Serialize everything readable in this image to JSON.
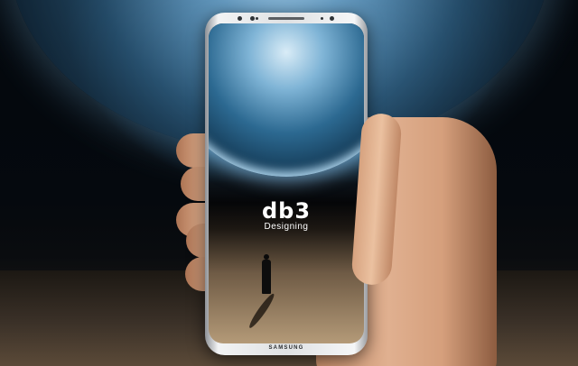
{
  "logo": {
    "mark": "db3",
    "subtitle": "Designing"
  },
  "phone": {
    "brand": "SAMSUNG"
  }
}
